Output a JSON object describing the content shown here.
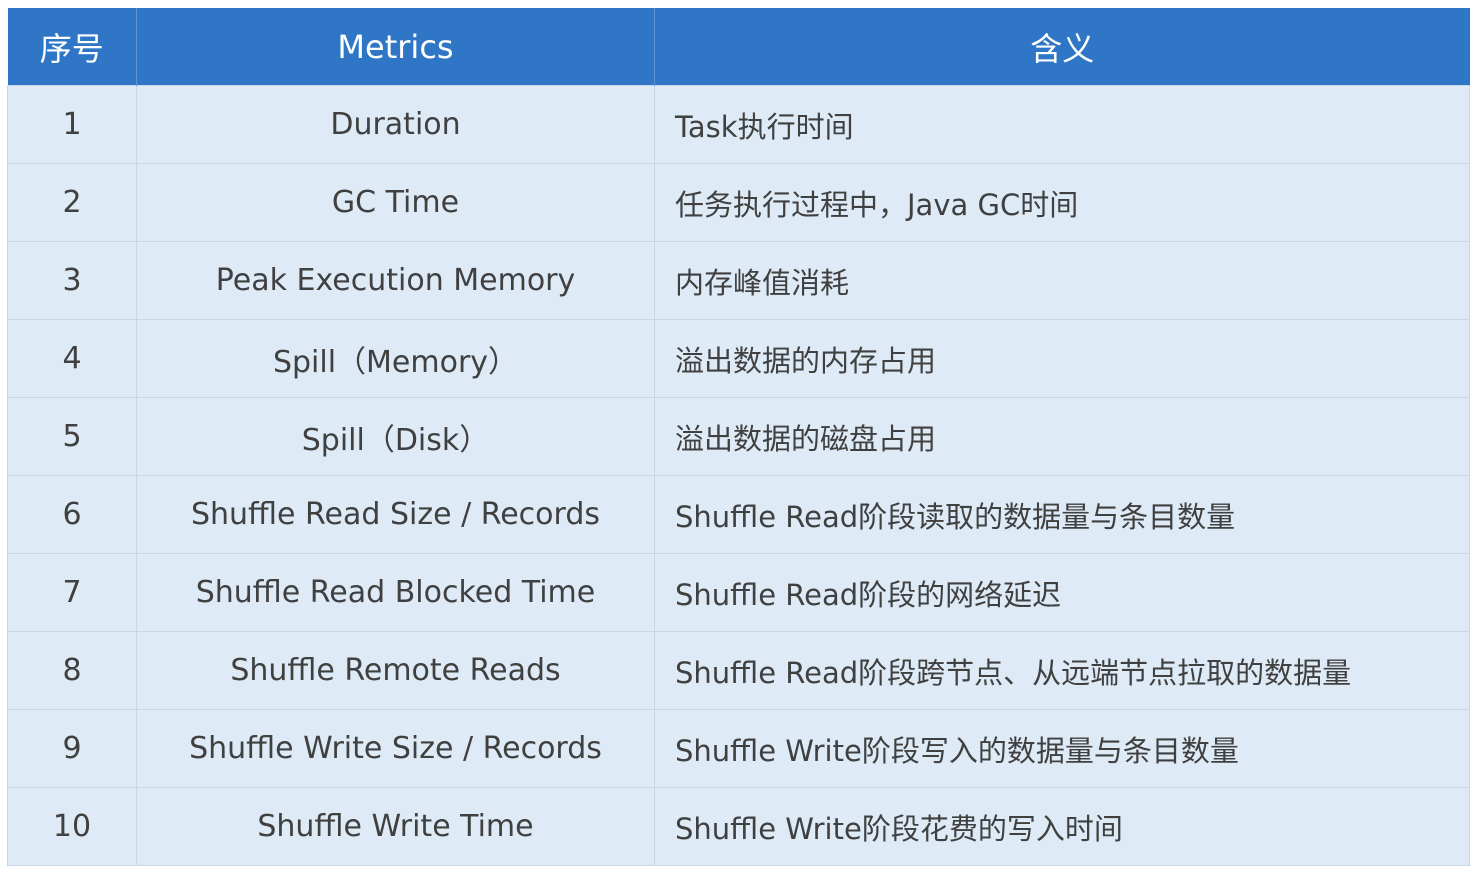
{
  "table": {
    "headers": {
      "index": "序号",
      "metric": "Metrics",
      "meaning": "含义"
    },
    "rows": [
      {
        "index": "1",
        "metric": "Duration",
        "meaning": "Task执行时间"
      },
      {
        "index": "2",
        "metric": "GC Time",
        "meaning": "任务执行过程中，Java GC时间"
      },
      {
        "index": "3",
        "metric": "Peak Execution Memory",
        "meaning": "内存峰值消耗"
      },
      {
        "index": "4",
        "metric": "Spill（Memory）",
        "meaning": "溢出数据的内存占用"
      },
      {
        "index": "5",
        "metric": "Spill（Disk）",
        "meaning": "溢出数据的磁盘占用"
      },
      {
        "index": "6",
        "metric": "Shuffle Read Size / Records",
        "meaning": "Shuffle Read阶段读取的数据量与条目数量"
      },
      {
        "index": "7",
        "metric": "Shuffle Read Blocked Time",
        "meaning": "Shuffle Read阶段的网络延迟"
      },
      {
        "index": "8",
        "metric": "Shuffle Remote Reads",
        "meaning": "Shuffle Read阶段跨节点、从远端节点拉取的数据量"
      },
      {
        "index": "9",
        "metric": "Shuffle Write Size / Records",
        "meaning": "Shuffle Write阶段写入的数据量与条目数量"
      },
      {
        "index": "10",
        "metric": "Shuffle Write Time",
        "meaning": "Shuffle Write阶段花费的写入时间"
      }
    ]
  },
  "colors": {
    "header_bg": "#2f77c6",
    "header_text": "#ffffff",
    "row_bg": "#deebf7",
    "row_text": "#404040",
    "border": "#c9d6e3"
  }
}
